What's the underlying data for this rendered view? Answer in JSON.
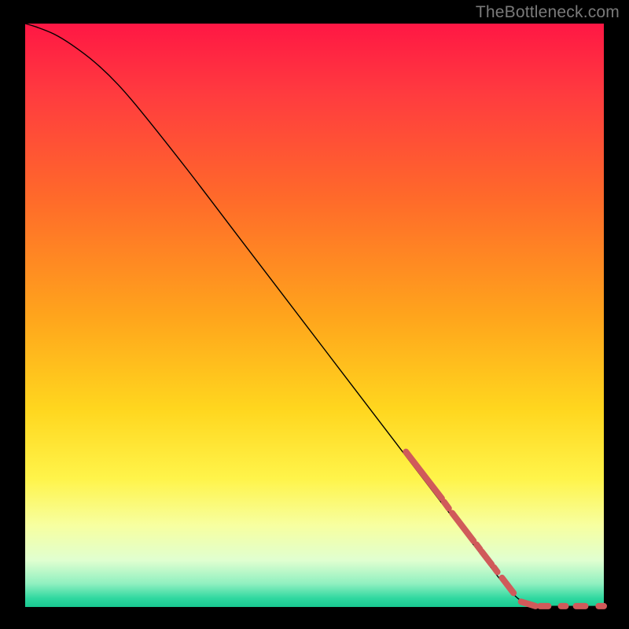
{
  "attribution": "TheBottleneck.com",
  "chart_data": {
    "type": "line",
    "title": "",
    "xlabel": "",
    "ylabel": "",
    "x_range": [
      0,
      100
    ],
    "y_range": [
      0,
      100
    ],
    "background_gradient": {
      "stops": [
        {
          "offset": 0.0,
          "color": "#ff1744"
        },
        {
          "offset": 0.12,
          "color": "#ff3b3f"
        },
        {
          "offset": 0.3,
          "color": "#ff6a2a"
        },
        {
          "offset": 0.5,
          "color": "#ffa41c"
        },
        {
          "offset": 0.66,
          "color": "#ffd61e"
        },
        {
          "offset": 0.78,
          "color": "#fff44a"
        },
        {
          "offset": 0.86,
          "color": "#f7ffa0"
        },
        {
          "offset": 0.92,
          "color": "#e0ffd0"
        },
        {
          "offset": 0.96,
          "color": "#90f0c0"
        },
        {
          "offset": 0.985,
          "color": "#30d8a0"
        },
        {
          "offset": 1.0,
          "color": "#18c890"
        }
      ]
    },
    "series": [
      {
        "name": "curve",
        "color": "#000000",
        "width": 1.4,
        "points": [
          {
            "x": 0.0,
            "y": 100.0
          },
          {
            "x": 2.0,
            "y": 99.4
          },
          {
            "x": 5.0,
            "y": 98.2
          },
          {
            "x": 8.0,
            "y": 96.4
          },
          {
            "x": 12.0,
            "y": 93.4
          },
          {
            "x": 16.0,
            "y": 89.6
          },
          {
            "x": 20.0,
            "y": 85.0
          },
          {
            "x": 28.0,
            "y": 75.0
          },
          {
            "x": 36.0,
            "y": 64.6
          },
          {
            "x": 44.0,
            "y": 54.2
          },
          {
            "x": 52.0,
            "y": 43.8
          },
          {
            "x": 60.0,
            "y": 33.4
          },
          {
            "x": 66.0,
            "y": 25.6
          },
          {
            "x": 72.0,
            "y": 17.8
          },
          {
            "x": 76.0,
            "y": 12.6
          },
          {
            "x": 80.0,
            "y": 7.4
          },
          {
            "x": 83.0,
            "y": 3.6
          },
          {
            "x": 85.0,
            "y": 1.6
          },
          {
            "x": 86.5,
            "y": 0.6
          },
          {
            "x": 88.0,
            "y": 0.15
          },
          {
            "x": 92.0,
            "y": 0.1
          },
          {
            "x": 100.0,
            "y": 0.1
          }
        ]
      }
    ],
    "highlight_dashes": {
      "color": "#d05a5a",
      "width": 8,
      "cap": "round",
      "segments": [
        [
          [
            65.8,
            26.6
          ],
          [
            72.0,
            18.6
          ]
        ],
        [
          [
            72.4,
            18.0
          ],
          [
            73.2,
            16.9
          ]
        ],
        [
          [
            73.8,
            16.1
          ],
          [
            77.5,
            11.3
          ]
        ],
        [
          [
            78.0,
            10.7
          ],
          [
            78.6,
            9.9
          ]
        ],
        [
          [
            78.9,
            9.5
          ],
          [
            80.6,
            7.3
          ]
        ],
        [
          [
            81.0,
            6.8
          ],
          [
            81.6,
            6.0
          ]
        ],
        [
          [
            82.4,
            5.0
          ],
          [
            84.4,
            2.4
          ]
        ],
        [
          [
            85.7,
            0.9
          ],
          [
            88.2,
            0.15
          ]
        ],
        [
          [
            89.0,
            0.15
          ],
          [
            90.4,
            0.15
          ]
        ],
        [
          [
            92.6,
            0.15
          ],
          [
            93.4,
            0.15
          ]
        ],
        [
          [
            95.2,
            0.15
          ],
          [
            96.8,
            0.15
          ]
        ],
        [
          [
            99.1,
            0.15
          ],
          [
            100.0,
            0.15
          ]
        ]
      ]
    }
  }
}
